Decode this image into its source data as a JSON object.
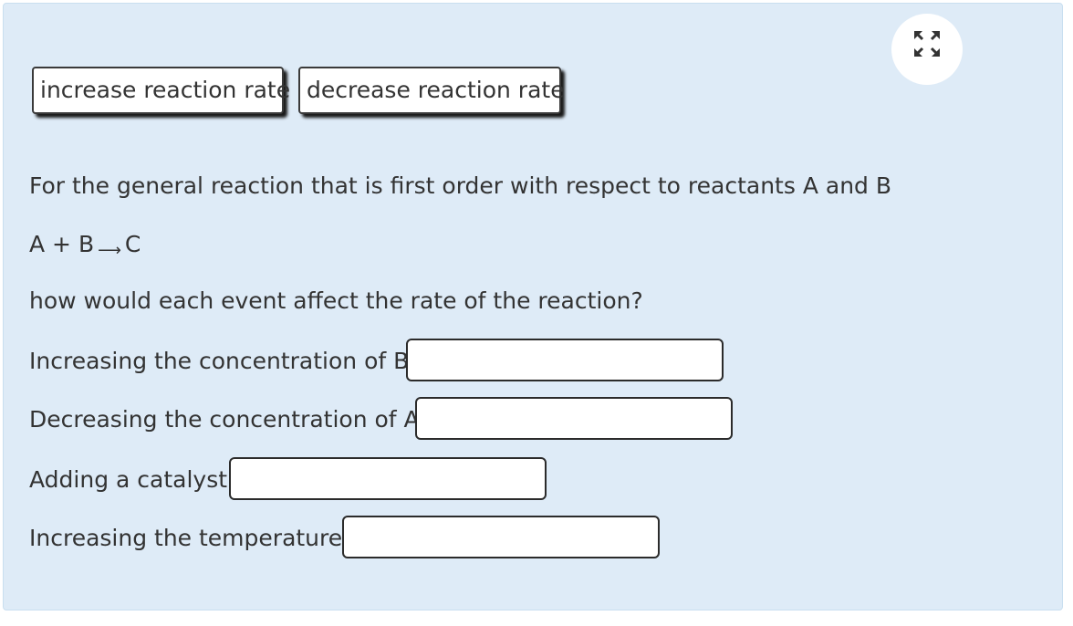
{
  "tiles": [
    {
      "label": "increase reaction rate"
    },
    {
      "label": "decrease reaction rate"
    }
  ],
  "question": {
    "intro": "For the general reaction that is first order with respect to reactants A and B",
    "equation_left": "A + B",
    "equation_arrow": "⟶",
    "equation_right": "C",
    "prompt": "how would each event affect the rate of the reaction?"
  },
  "events": [
    {
      "label": "Increasing the concentration of B:",
      "answer": ""
    },
    {
      "label": "Decreasing the concentration of A:",
      "answer": ""
    },
    {
      "label": "Adding a catalyst:",
      "answer": ""
    },
    {
      "label": "Increasing the temperature:",
      "answer": ""
    }
  ],
  "icons": {
    "expand": "expand-arrows-icon"
  },
  "colors": {
    "panel": "#deebf7",
    "text": "#333333",
    "border": "#2b2b2b"
  }
}
